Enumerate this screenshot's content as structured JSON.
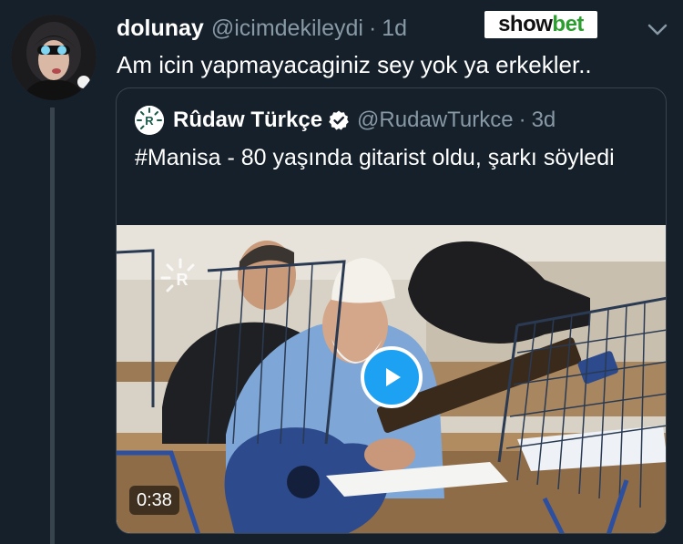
{
  "tweet": {
    "author_name": "dolunay",
    "author_handle": "@icimdekileydi",
    "separator": "·",
    "time": "1d",
    "text": "Am icin yapmayacaginiz sey yok ya erkekler.."
  },
  "watermark": {
    "part1": "show",
    "part2": "bet"
  },
  "quoted_tweet": {
    "author_name": "Rûdaw Türkçe",
    "author_handle": "@RudawTurkce",
    "separator": "·",
    "time": "3d",
    "text": "#Manisa - 80 yaşında gitarist oldu, şarkı söyledi",
    "verified": true
  },
  "video": {
    "duration": "0:38",
    "play_icon": "play-icon"
  },
  "icons": {
    "menu": "chevron-down-icon",
    "verified": "verified-badge-icon"
  },
  "colors": {
    "background": "#15202b",
    "secondary_text": "#8899a6",
    "accent": "#1da1f2",
    "border": "#38444d"
  }
}
